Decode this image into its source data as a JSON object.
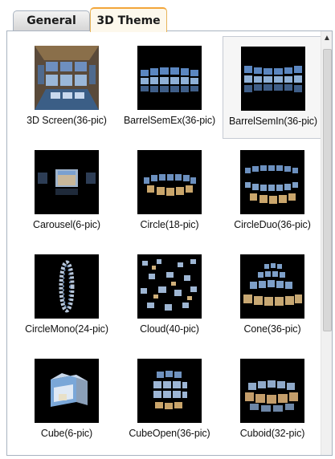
{
  "tabs": [
    {
      "label": "General",
      "active": false
    },
    {
      "label": "3D Theme",
      "active": true
    }
  ],
  "themes": [
    {
      "label": "3D Screen(36-pic)",
      "icon": "3d-screen-thumbnail-icon"
    },
    {
      "label": "BarrelSemEx(36-pic)",
      "icon": "barrel-sem-ex-thumbnail-icon"
    },
    {
      "label": "BarrelSemIn(36-pic)",
      "icon": "barrel-sem-in-thumbnail-icon",
      "selected": true
    },
    {
      "label": "Carousel(6-pic)",
      "icon": "carousel-thumbnail-icon"
    },
    {
      "label": "Circle(18-pic)",
      "icon": "circle-thumbnail-icon"
    },
    {
      "label": "CircleDuo(36-pic)",
      "icon": "circle-duo-thumbnail-icon"
    },
    {
      "label": "CircleMono(24-pic)",
      "icon": "circle-mono-thumbnail-icon"
    },
    {
      "label": "Cloud(40-pic)",
      "icon": "cloud-thumbnail-icon"
    },
    {
      "label": "Cone(36-pic)",
      "icon": "cone-thumbnail-icon"
    },
    {
      "label": "Cube(6-pic)",
      "icon": "cube-thumbnail-icon"
    },
    {
      "label": "CubeOpen(36-pic)",
      "icon": "cube-open-thumbnail-icon"
    },
    {
      "label": "Cuboid(32-pic)",
      "icon": "cuboid-thumbnail-icon"
    }
  ],
  "colors": {
    "active_tab_accent": "#f3a63a",
    "thumbnail_bg": "#000000"
  }
}
